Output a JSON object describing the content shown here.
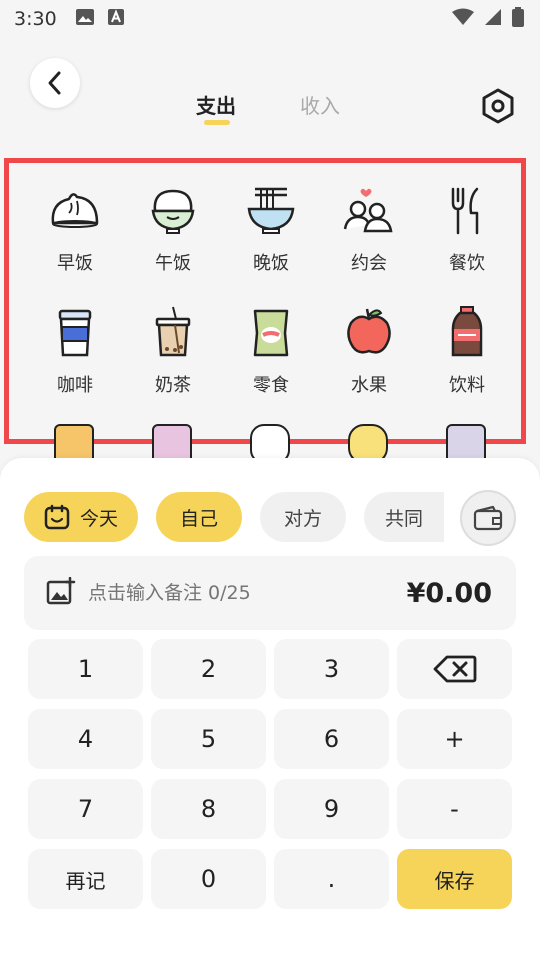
{
  "status_bar": {
    "time": "3:30"
  },
  "header": {
    "tab_expense": "支出",
    "tab_income": "收入"
  },
  "categories": [
    {
      "label": "早饭",
      "icon": "steamed-bun-icon"
    },
    {
      "label": "午饭",
      "icon": "rice-bowl-icon"
    },
    {
      "label": "晚饭",
      "icon": "noodle-bowl-icon"
    },
    {
      "label": "约会",
      "icon": "couple-icon"
    },
    {
      "label": "餐饮",
      "icon": "fork-knife-icon"
    },
    {
      "label": "咖啡",
      "icon": "coffee-cup-icon"
    },
    {
      "label": "奶茶",
      "icon": "milk-tea-icon"
    },
    {
      "label": "零食",
      "icon": "snack-bag-icon"
    },
    {
      "label": "水果",
      "icon": "apple-icon"
    },
    {
      "label": "饮料",
      "icon": "cola-bottle-icon"
    }
  ],
  "chips": {
    "today": "今天",
    "self": "自己",
    "other": "对方",
    "joint": "共同"
  },
  "note": {
    "placeholder": "点击输入备注 0/25",
    "amount": "¥0.00"
  },
  "keypad": {
    "k1": "1",
    "k2": "2",
    "k3": "3",
    "k4": "4",
    "k5": "5",
    "k6": "6",
    "plus": "+",
    "k7": "7",
    "k8": "8",
    "k9": "9",
    "minus": "-",
    "again": "再记",
    "k0": "0",
    "dot": ".",
    "save": "保存"
  },
  "colors": {
    "accent": "#f6d45a",
    "highlight_border": "#f0484a"
  }
}
